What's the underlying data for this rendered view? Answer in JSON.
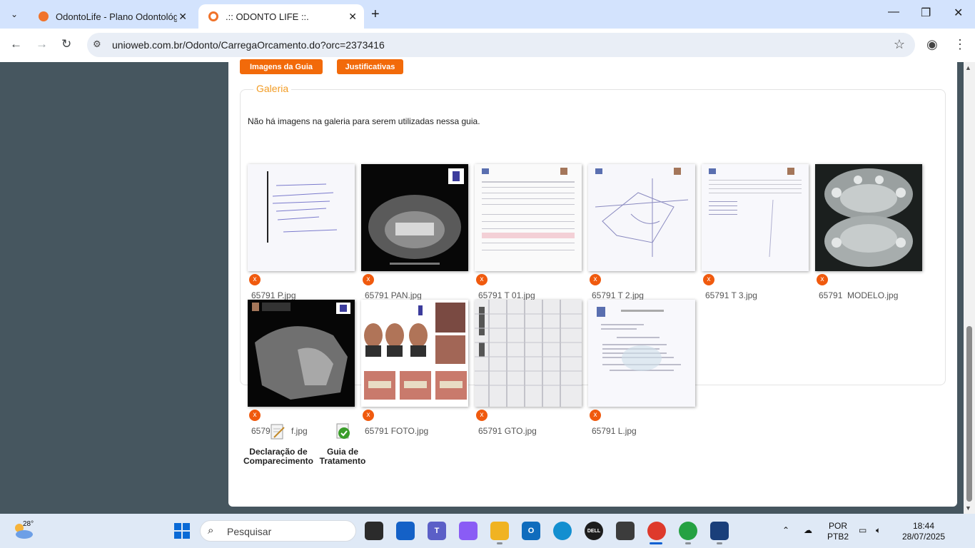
{
  "browser": {
    "tabs": [
      {
        "title": "OdontoLife - Plano Odontológico",
        "active": false
      },
      {
        "title": ".:: ODONTO LIFE ::.",
        "active": true
      }
    ],
    "url_host": "unioweb.com.br",
    "url_path": "/Odonto/CarregaOrcamento.do?orc=2373416"
  },
  "page": {
    "buttons": {
      "images": "Imagens da Guia",
      "justifications": "Justificativas"
    },
    "gallery": {
      "legend": "Galeria",
      "empty_message": "Não há imagens na galeria para serem utilizadas nessa guia.",
      "files": [
        "65791 P.jpg",
        "65791 PAN.jpg",
        "65791 T 01.jpg",
        "65791 T 2.jpg",
        "65791 T 3.jpg",
        "65791  MODELO.jpg",
        "65791 ...f.jpg",
        "65791 FOTO.jpg",
        "65791 GTO.jpg",
        "65791 L.jpg"
      ],
      "file_7_prefix": "6579",
      "file_7_suffix": "f.jpg",
      "delete_label": "x"
    },
    "documents": [
      {
        "line1": "Declaração de",
        "line2": "Comparecimento"
      },
      {
        "line1": "Guia de",
        "line2": "Tratamento"
      }
    ]
  },
  "taskbar": {
    "temperature": "28°",
    "search_placeholder": "Pesquisar",
    "language": "POR",
    "keyboard": "PTB2",
    "time": "18:44",
    "date": "28/07/2025"
  }
}
